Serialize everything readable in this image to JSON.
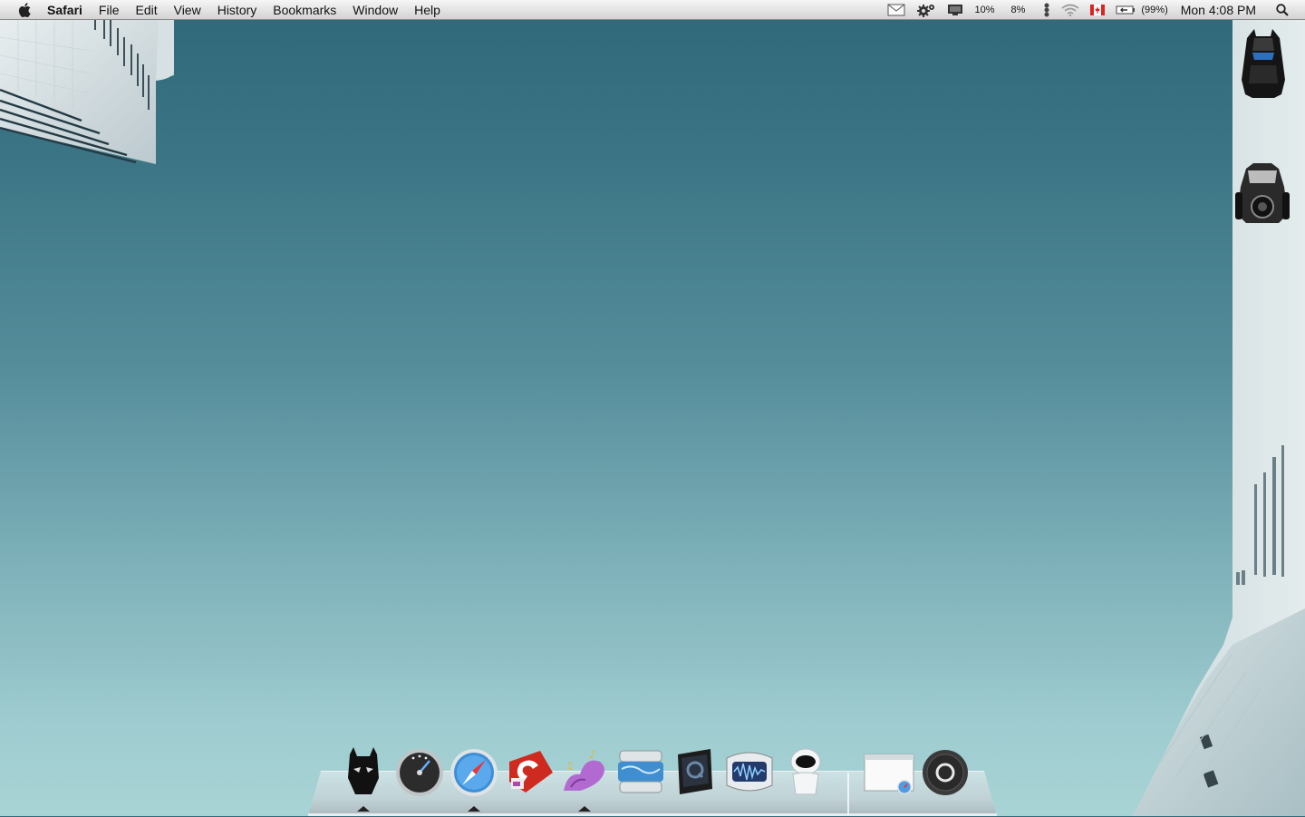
{
  "menubar": {
    "app_name": "Safari",
    "menus": [
      "File",
      "Edit",
      "View",
      "History",
      "Bookmarks",
      "Window",
      "Help"
    ],
    "status": {
      "cpu1": "10%",
      "cpu2": "8%",
      "battery": "(99%)",
      "clock": "Mon 4:08 PM"
    },
    "status_icons": [
      "mail-icon",
      "gears-icon",
      "display-icon",
      "bluetooth-icon",
      "wifi-icon",
      "canada-flag-icon",
      "battery-icon",
      "spotlight-icon"
    ]
  },
  "desktop_icons": [
    "batmobile-top-icon",
    "batmobile-front-icon"
  ],
  "dock": {
    "apps": [
      {
        "icon": "batman-mask-icon",
        "running": true
      },
      {
        "icon": "dashboard-gauge-icon",
        "running": false
      },
      {
        "icon": "safari-compass-icon",
        "running": true
      },
      {
        "icon": "red-app-icon",
        "running": false
      },
      {
        "icon": "purple-music-creature-icon",
        "running": true
      },
      {
        "icon": "blue-layered-app-icon",
        "running": false
      },
      {
        "icon": "dark-q-tablet-icon",
        "running": false
      },
      {
        "icon": "audio-waveform-icon",
        "running": false
      },
      {
        "icon": "robot-eve-icon",
        "running": false
      }
    ],
    "stacks": [
      {
        "icon": "safari-window-stack-icon"
      },
      {
        "icon": "dark-dial-icon"
      }
    ]
  },
  "colors": {
    "sky_top": "#2f6878",
    "sky_bottom": "#a9d4d6",
    "menubar": "#e3e3e3"
  }
}
